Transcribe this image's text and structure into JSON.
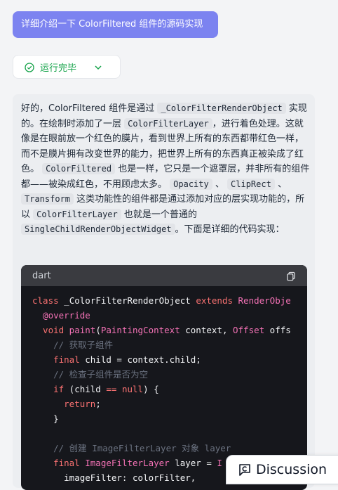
{
  "user_message": "详细介绍一下 ColorFiltered 组件的源码实现",
  "status": {
    "label": "运行完毕",
    "icons": [
      "check-circle-icon",
      "chevron-down-icon"
    ],
    "color": "#16a34a"
  },
  "answer": {
    "p1": "好的，ColorFiltered 组件是通过",
    "c1": "_ColorFilterRenderObject",
    "p2": "实现的。在绘制时添加了一层",
    "c2": "ColorFilterLayer",
    "p3": "，进行着色处理。这就像是在眼前放一个红色的膜片，看到世界上所有的东西都带红色一样，而不是膜片拥有改变世界的能力，把世界上所有的东西真正被染成了红色。",
    "c3": "ColorFiltered",
    "p4": "也是一样，它只是一个遮罩层，并非所有的组件都——被染成红色，不用顾虑太多。",
    "c4": "Opacity",
    "p5": "、",
    "c5": "ClipRect",
    "p6": "、",
    "c6": "Transform",
    "p7": "这类功能性的组件都是通过添加对应的层实现功能的，所以",
    "c7": "ColorFilterLayer",
    "p8": "也就是一个普通的",
    "c8": "SingleChildRenderObjectWidget",
    "p9": "。下面是详细的代码实现："
  },
  "codeblock": {
    "language": "dart",
    "copy_icon": "copy-icon",
    "lines": {
      "l1": {
        "kw1": "class",
        "name": " _ColorFilterRenderObject ",
        "kw2": "extends",
        "ty": " RenderObje"
      },
      "l2": {
        "ann": "  @override"
      },
      "l3": {
        "kw": "  void",
        "fn": " paint",
        "p1": "(",
        "ty1": "PaintingContext",
        "p2": " context, ",
        "ty2": "Offset",
        "p3": " offs"
      },
      "l4": {
        "cm": "    // 获取子组件"
      },
      "l5": {
        "kw": "    final",
        "rest": " child = context.child;"
      },
      "l6": {
        "cm": "    // 检查子组件是否为空"
      },
      "l7": {
        "kw": "    if",
        "p1": " (child ",
        "op": "==",
        "p2": " ",
        "kw2": "null",
        "p3": ") {"
      },
      "l8": {
        "kw": "      return",
        "p": ";"
      },
      "l9": {
        "p": "    }"
      },
      "l10": {
        "p": ""
      },
      "l11": {
        "cm": "    // 创建 ImageFilterLayer 对象 layer"
      },
      "l12": {
        "kw": "    final",
        "ty": " ImageFilterLayer",
        "p": " layer = ",
        "ty2": "I"
      },
      "l13": {
        "p": "      imageFilter: colorFilter,"
      }
    }
  },
  "discussion": {
    "label": "Discussion",
    "icon": "chat-c-icon"
  }
}
